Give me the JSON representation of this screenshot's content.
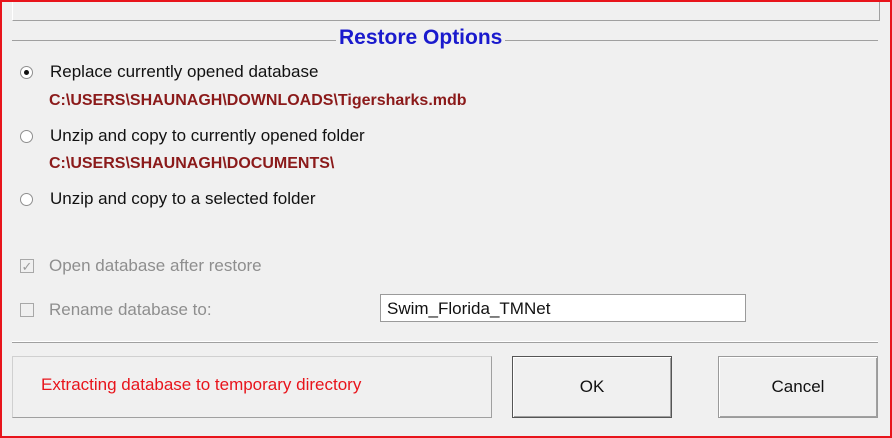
{
  "dialog": {
    "group_title": "Restore Options",
    "options": [
      {
        "label": "Replace currently opened database",
        "path": "C:\\USERS\\SHAUNAGH\\DOWNLOADS\\Tigersharks.mdb",
        "selected": true
      },
      {
        "label": "Unzip and copy to currently opened folder",
        "path": "C:\\USERS\\SHAUNAGH\\DOCUMENTS\\",
        "selected": false
      },
      {
        "label": "Unzip and copy to a selected folder",
        "selected": false
      }
    ],
    "open_after_restore": {
      "label": "Open database after restore",
      "checked": true,
      "enabled": false
    },
    "rename": {
      "label": "Rename database to:",
      "checked": false,
      "enabled": false,
      "value": "Swim_Florida_TMNet"
    },
    "status_text": "Extracting database to temporary directory",
    "ok_label": "OK",
    "cancel_label": "Cancel"
  },
  "colors": {
    "frame_border": "#e8141b",
    "title": "#1a1acd",
    "path": "#8b1a1a",
    "status": "#e8141b",
    "disabled_text": "#8e8e8e"
  }
}
